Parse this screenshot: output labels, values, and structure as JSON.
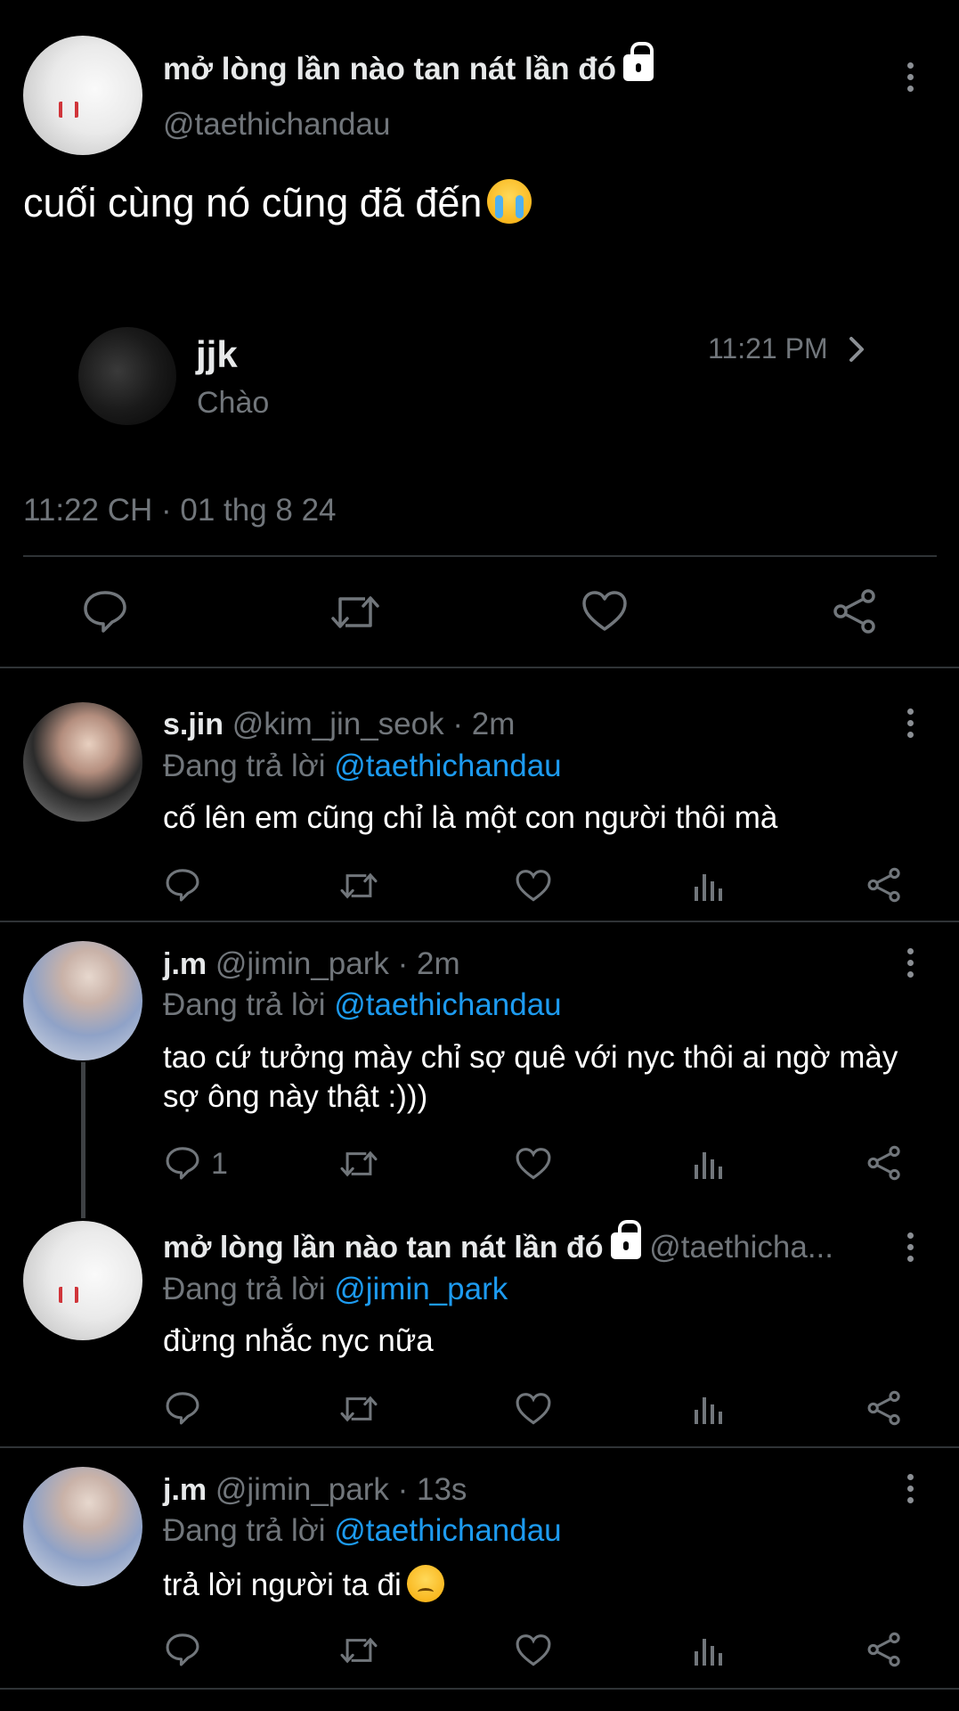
{
  "main_tweet": {
    "display_name": "mở lòng lần nào tan nát lần đó",
    "handle": "@taethichandau",
    "text": "cuối cùng nó cũng đã đến",
    "timestamp": "11:22 CH · 01 thg 8 24",
    "quoted": {
      "name": "jjk",
      "message": "Chào",
      "time": "11:21 PM"
    },
    "actions": [
      "reply",
      "retweet",
      "like",
      "share"
    ]
  },
  "replies": [
    {
      "name": "s.jin",
      "handle": "@kim_jin_seok",
      "time": "· 2m",
      "replying_label": "Đang trả lời",
      "replying_to": "@taethichandau",
      "text": "cố lên em cũng chỉ là một con người thôi mà",
      "reply_count": ""
    },
    {
      "name": "j.m",
      "handle": "@jimin_park",
      "time": "· 2m",
      "replying_label": "Đang trả lời",
      "replying_to": "@taethichandau",
      "text": "tao cứ tưởng mày chỉ sợ quê với nyc thôi ai ngờ mày sợ ông này thật :)))",
      "reply_count": "1"
    },
    {
      "name": "mở lòng lần nào tan nát lần đó",
      "handle": "@taethicha...",
      "time": "",
      "replying_label": "Đang trả lời",
      "replying_to": "@jimin_park",
      "text": "đừng nhắc nyc nữa",
      "reply_count": ""
    },
    {
      "name": "j.m",
      "handle": "@jimin_park",
      "time": "· 13s",
      "replying_label": "Đang trả lời",
      "replying_to": "@taethichandau",
      "text": "trả lời người ta đi",
      "reply_count": ""
    }
  ],
  "icons": {
    "reply": "speech-bubble-icon",
    "retweet": "retweet-arrows-icon",
    "like": "heart-icon",
    "views": "bar-chart-icon",
    "share": "share-nodes-icon",
    "more": "kebab-icon",
    "lock": "lock-icon"
  },
  "colors": {
    "background": "#000000",
    "text": "#e7e9ea",
    "muted": "#71767b",
    "link": "#1d9bf0",
    "divider": "#2f3336"
  }
}
